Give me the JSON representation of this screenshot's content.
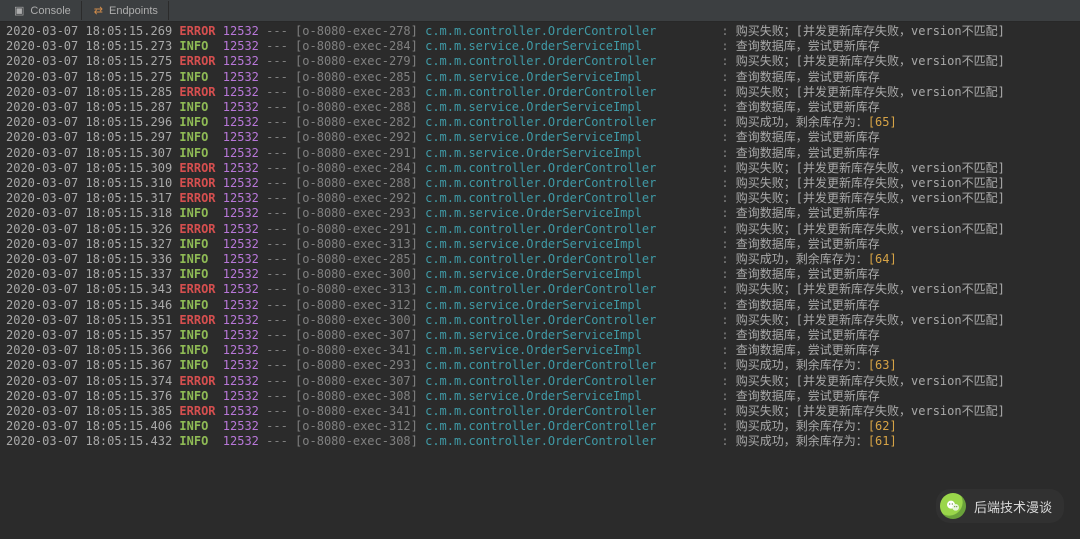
{
  "tabs": [
    {
      "icon": "▣",
      "label": "Console"
    },
    {
      "icon": "⇄",
      "label": "Endpoints"
    }
  ],
  "logs": [
    {
      "ts": "2020-03-07 18:05:15.269",
      "level": "ERROR",
      "pid": "12532",
      "thread": "[o-8080-exec-278]",
      "logger": "c.m.m.controller.OrderController",
      "msg": "购买失败；[并发更新库存失败，version不匹配]"
    },
    {
      "ts": "2020-03-07 18:05:15.273",
      "level": "INFO",
      "pid": "12532",
      "thread": "[o-8080-exec-284]",
      "logger": "c.m.m.service.OrderServiceImpl",
      "msg": "查询数据库，尝试更新库存"
    },
    {
      "ts": "2020-03-07 18:05:15.275",
      "level": "ERROR",
      "pid": "12532",
      "thread": "[o-8080-exec-279]",
      "logger": "c.m.m.controller.OrderController",
      "msg": "购买失败；[并发更新库存失败，version不匹配]"
    },
    {
      "ts": "2020-03-07 18:05:15.275",
      "level": "INFO",
      "pid": "12532",
      "thread": "[o-8080-exec-285]",
      "logger": "c.m.m.service.OrderServiceImpl",
      "msg": "查询数据库，尝试更新库存"
    },
    {
      "ts": "2020-03-07 18:05:15.285",
      "level": "ERROR",
      "pid": "12532",
      "thread": "[o-8080-exec-283]",
      "logger": "c.m.m.controller.OrderController",
      "msg": "购买失败；[并发更新库存失败，version不匹配]"
    },
    {
      "ts": "2020-03-07 18:05:15.287",
      "level": "INFO",
      "pid": "12532",
      "thread": "[o-8080-exec-288]",
      "logger": "c.m.m.service.OrderServiceImpl",
      "msg": "查询数据库，尝试更新库存"
    },
    {
      "ts": "2020-03-07 18:05:15.296",
      "level": "INFO",
      "pid": "12532",
      "thread": "[o-8080-exec-282]",
      "logger": "c.m.m.controller.OrderController",
      "msg": "购买成功，剩余库存为：",
      "hl": "[65]"
    },
    {
      "ts": "2020-03-07 18:05:15.297",
      "level": "INFO",
      "pid": "12532",
      "thread": "[o-8080-exec-292]",
      "logger": "c.m.m.service.OrderServiceImpl",
      "msg": "查询数据库，尝试更新库存"
    },
    {
      "ts": "2020-03-07 18:05:15.307",
      "level": "INFO",
      "pid": "12532",
      "thread": "[o-8080-exec-291]",
      "logger": "c.m.m.service.OrderServiceImpl",
      "msg": "查询数据库，尝试更新库存"
    },
    {
      "ts": "2020-03-07 18:05:15.309",
      "level": "ERROR",
      "pid": "12532",
      "thread": "[o-8080-exec-284]",
      "logger": "c.m.m.controller.OrderController",
      "msg": "购买失败；[并发更新库存失败，version不匹配]"
    },
    {
      "ts": "2020-03-07 18:05:15.310",
      "level": "ERROR",
      "pid": "12532",
      "thread": "[o-8080-exec-288]",
      "logger": "c.m.m.controller.OrderController",
      "msg": "购买失败；[并发更新库存失败，version不匹配]"
    },
    {
      "ts": "2020-03-07 18:05:15.317",
      "level": "ERROR",
      "pid": "12532",
      "thread": "[o-8080-exec-292]",
      "logger": "c.m.m.controller.OrderController",
      "msg": "购买失败；[并发更新库存失败，version不匹配]"
    },
    {
      "ts": "2020-03-07 18:05:15.318",
      "level": "INFO",
      "pid": "12532",
      "thread": "[o-8080-exec-293]",
      "logger": "c.m.m.service.OrderServiceImpl",
      "msg": "查询数据库，尝试更新库存"
    },
    {
      "ts": "2020-03-07 18:05:15.326",
      "level": "ERROR",
      "pid": "12532",
      "thread": "[o-8080-exec-291]",
      "logger": "c.m.m.controller.OrderController",
      "msg": "购买失败；[并发更新库存失败，version不匹配]"
    },
    {
      "ts": "2020-03-07 18:05:15.327",
      "level": "INFO",
      "pid": "12532",
      "thread": "[o-8080-exec-313]",
      "logger": "c.m.m.service.OrderServiceImpl",
      "msg": "查询数据库，尝试更新库存"
    },
    {
      "ts": "2020-03-07 18:05:15.336",
      "level": "INFO",
      "pid": "12532",
      "thread": "[o-8080-exec-285]",
      "logger": "c.m.m.controller.OrderController",
      "msg": "购买成功，剩余库存为：",
      "hl": "[64]"
    },
    {
      "ts": "2020-03-07 18:05:15.337",
      "level": "INFO",
      "pid": "12532",
      "thread": "[o-8080-exec-300]",
      "logger": "c.m.m.service.OrderServiceImpl",
      "msg": "查询数据库，尝试更新库存"
    },
    {
      "ts": "2020-03-07 18:05:15.343",
      "level": "ERROR",
      "pid": "12532",
      "thread": "[o-8080-exec-313]",
      "logger": "c.m.m.controller.OrderController",
      "msg": "购买失败；[并发更新库存失败，version不匹配]"
    },
    {
      "ts": "2020-03-07 18:05:15.346",
      "level": "INFO",
      "pid": "12532",
      "thread": "[o-8080-exec-312]",
      "logger": "c.m.m.service.OrderServiceImpl",
      "msg": "查询数据库，尝试更新库存"
    },
    {
      "ts": "2020-03-07 18:05:15.351",
      "level": "ERROR",
      "pid": "12532",
      "thread": "[o-8080-exec-300]",
      "logger": "c.m.m.controller.OrderController",
      "msg": "购买失败；[并发更新库存失败，version不匹配]"
    },
    {
      "ts": "2020-03-07 18:05:15.357",
      "level": "INFO",
      "pid": "12532",
      "thread": "[o-8080-exec-307]",
      "logger": "c.m.m.service.OrderServiceImpl",
      "msg": "查询数据库，尝试更新库存"
    },
    {
      "ts": "2020-03-07 18:05:15.366",
      "level": "INFO",
      "pid": "12532",
      "thread": "[o-8080-exec-341]",
      "logger": "c.m.m.service.OrderServiceImpl",
      "msg": "查询数据库，尝试更新库存"
    },
    {
      "ts": "2020-03-07 18:05:15.367",
      "level": "INFO",
      "pid": "12532",
      "thread": "[o-8080-exec-293]",
      "logger": "c.m.m.controller.OrderController",
      "msg": "购买成功，剩余库存为：",
      "hl": "[63]"
    },
    {
      "ts": "2020-03-07 18:05:15.374",
      "level": "ERROR",
      "pid": "12532",
      "thread": "[o-8080-exec-307]",
      "logger": "c.m.m.controller.OrderController",
      "msg": "购买失败；[并发更新库存失败，version不匹配]"
    },
    {
      "ts": "2020-03-07 18:05:15.376",
      "level": "INFO",
      "pid": "12532",
      "thread": "[o-8080-exec-308]",
      "logger": "c.m.m.service.OrderServiceImpl",
      "msg": "查询数据库，尝试更新库存"
    },
    {
      "ts": "2020-03-07 18:05:15.385",
      "level": "ERROR",
      "pid": "12532",
      "thread": "[o-8080-exec-341]",
      "logger": "c.m.m.controller.OrderController",
      "msg": "购买失败；[并发更新库存失败，version不匹配]"
    },
    {
      "ts": "2020-03-07 18:05:15.406",
      "level": "INFO",
      "pid": "12532",
      "thread": "[o-8080-exec-312]",
      "logger": "c.m.m.controller.OrderController",
      "msg": "购买成功，剩余库存为：",
      "hl": "[62]"
    },
    {
      "ts": "2020-03-07 18:05:15.432",
      "level": "INFO",
      "pid": "12532",
      "thread": "[o-8080-exec-308]",
      "logger": "c.m.m.controller.OrderController",
      "msg": "购买成功，剩余库存为：",
      "hl": "[61]"
    }
  ],
  "overlay": {
    "label": "后端技术漫谈"
  }
}
